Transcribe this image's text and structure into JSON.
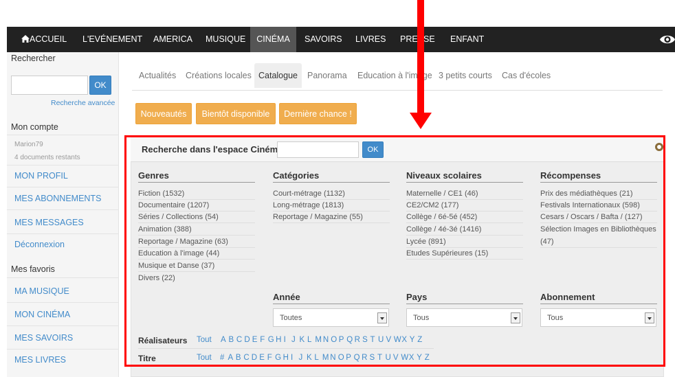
{
  "nav": {
    "items": [
      "ACCUEIL",
      "L'EVÉNEMENT",
      "AMERICA",
      "MUSIQUE",
      "CINÉMA",
      "SAVOIRS",
      "LIVRES",
      "PRESSE",
      "ENFANT"
    ],
    "active": "CINÉMA"
  },
  "sidebar": {
    "search_label": "Rechercher",
    "ok": "OK",
    "advanced": "Recherche avancée",
    "account_title": "Mon compte",
    "user": "Marion79",
    "docs_left": "4 documents restants",
    "links": [
      "MON PROFIL",
      "MES ABONNEMENTS",
      "MES MESSAGES",
      "Déconnexion"
    ],
    "favorites_title": "Mes favoris",
    "favorites": [
      "MA MUSIQUE",
      "MON CINÉMA",
      "MES SAVOIRS",
      "MES LIVRES"
    ]
  },
  "tabs": [
    "Actualités",
    "Créations locales",
    "Catalogue",
    "Panorama",
    "Education à l'image",
    "3 petits courts",
    "Cas d'écoles"
  ],
  "active_tab": "Catalogue",
  "buttons": [
    "Nouveautés",
    "Bientôt disponible",
    "Dernière chance !"
  ],
  "panel": {
    "title": "Recherche dans l'espace Cinéma",
    "ok": "OK",
    "genres": {
      "title": "Genres",
      "items": [
        "Fiction (1532)",
        "Documentaire (1207)",
        "Séries / Collections (54)",
        "Animation (388)",
        "Reportage / Magazine (63)",
        "Education à l'image (44)",
        "Musique et Danse (37)",
        "Divers (22)"
      ]
    },
    "categories": {
      "title": "Catégories",
      "items": [
        "Court-métrage (1132)",
        "Long-métrage (1813)",
        "Reportage / Magazine (55)"
      ]
    },
    "niveaux": {
      "title": "Niveaux scolaires",
      "items": [
        "Maternelle / CE1 (46)",
        "CE2/CM2 (177)",
        "Collège / 6é-5é (452)",
        "Collège / 4é-3é (1416)",
        "Lycée (891)",
        "Etudes Supérieures (15)"
      ]
    },
    "recompenses": {
      "title": "Récompenses",
      "items": [
        "Prix des médiathèques (21)",
        "Festivals Internationaux (598)",
        "Cesars / Oscars / Bafta / (127)",
        "Sélection Images en Bibliothèques",
        "(47)"
      ]
    },
    "annee": {
      "title": "Année",
      "value": "Toutes"
    },
    "pays": {
      "title": "Pays",
      "value": "Tous"
    },
    "abonnement": {
      "title": "Abonnement",
      "value": "Tous"
    },
    "realisateurs": {
      "label": "Réalisateurs",
      "all": "Tout",
      "letters": [
        "A",
        "B",
        "C",
        "D",
        "E",
        "F",
        "G",
        "H",
        "I",
        "J",
        "K",
        "L",
        "M",
        "N",
        "O",
        "P",
        "Q",
        "R",
        "S",
        "T",
        "U",
        "V",
        "W",
        "X",
        "Y",
        "Z"
      ]
    },
    "titre": {
      "label": "Titre",
      "all": "Tout",
      "letters": [
        "#",
        "A",
        "B",
        "C",
        "D",
        "E",
        "F",
        "G",
        "H",
        "I",
        "J",
        "K",
        "L",
        "M",
        "N",
        "O",
        "P",
        "Q",
        "R",
        "S",
        "T",
        "U",
        "V",
        "W",
        "X",
        "Y",
        "Z"
      ]
    }
  },
  "colors": {
    "nav_bg": "#222222",
    "nav_active": "#555555",
    "link": "#428bca",
    "orange": "#f0ad4e",
    "annotation": "#ff0000"
  }
}
